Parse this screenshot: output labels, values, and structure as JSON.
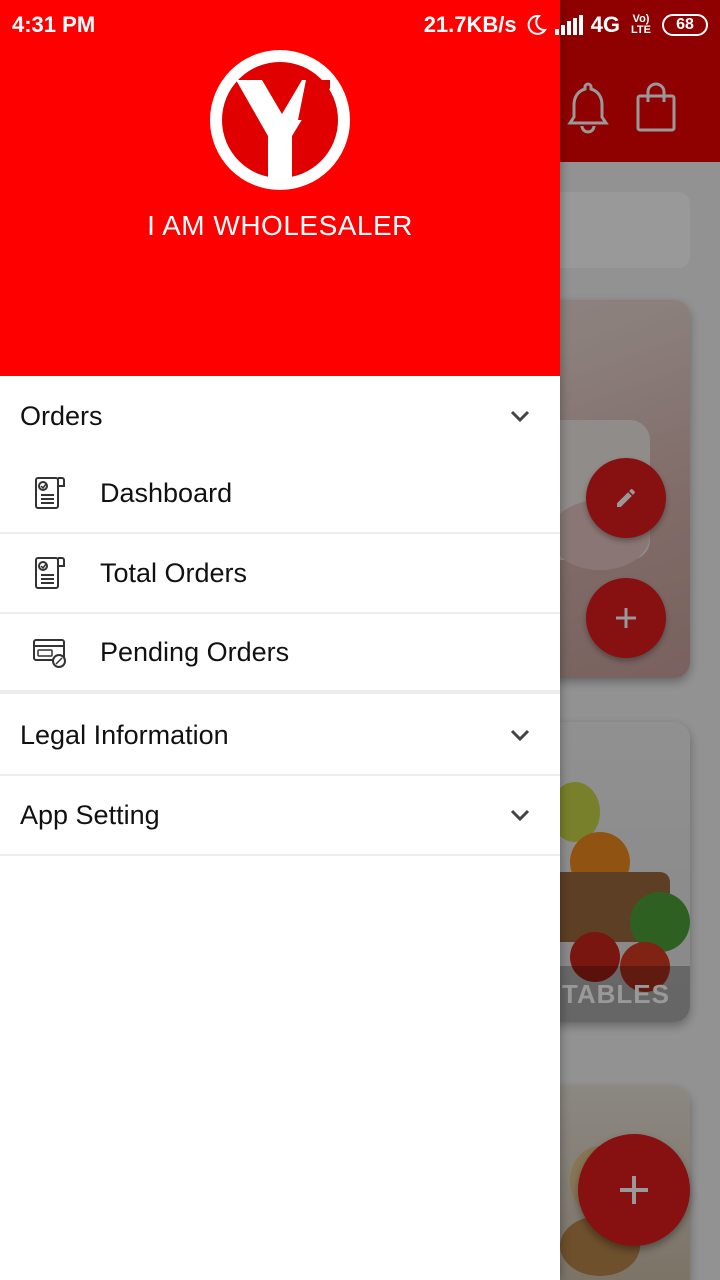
{
  "status_bar": {
    "time": "4:31 PM",
    "speed": "21.7KB/s",
    "network": "4G",
    "volte_label": "Vo) LTE",
    "battery": "68"
  },
  "drawer": {
    "brand_name": "I AM WHOLESALER",
    "logo_icon": "y-logo-icon",
    "accent_color": "#fe0000",
    "sections": [
      {
        "label": "Orders",
        "expanded": true,
        "items": [
          {
            "label": "Dashboard",
            "icon": "receipt-icon"
          },
          {
            "label": "Total Orders",
            "icon": "receipt-icon"
          },
          {
            "label": "Pending Orders",
            "icon": "card-discount-icon"
          }
        ]
      },
      {
        "label": "Legal Information",
        "expanded": false
      },
      {
        "label": "App Setting",
        "expanded": false
      }
    ]
  },
  "background": {
    "card_label": "GITABLES",
    "app_bar_icons": [
      "bell-icon",
      "shopping-bag-icon"
    ],
    "fab_icons": [
      "pencil-icon",
      "plus-icon",
      "plus-icon"
    ]
  }
}
